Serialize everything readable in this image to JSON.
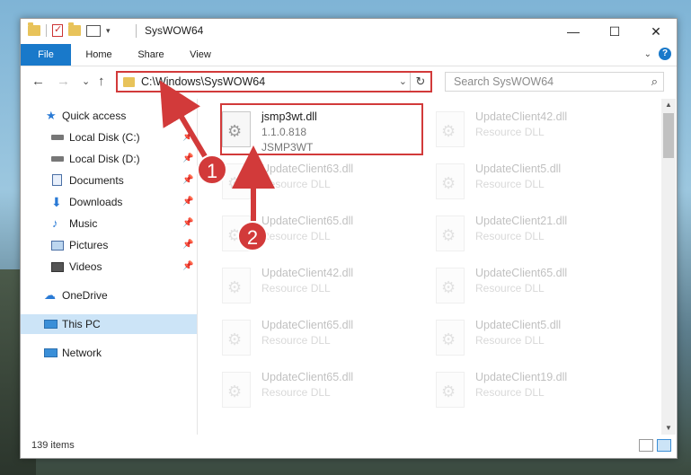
{
  "window": {
    "title": "SysWOW64",
    "controls": {
      "minimize": "—",
      "maximize": "☐",
      "close": "✕"
    }
  },
  "ribbon": {
    "tabs": [
      {
        "label": "File",
        "active": true
      },
      {
        "label": "Home"
      },
      {
        "label": "Share"
      },
      {
        "label": "View"
      }
    ]
  },
  "address_bar": {
    "path": "C:\\Windows\\SysWOW64",
    "back": "←",
    "forward": "→",
    "recent": "⌄",
    "up": "↑",
    "refresh": "↻",
    "dropdown": "⌄"
  },
  "search": {
    "placeholder": "Search SysWOW64",
    "icon": "⌕"
  },
  "nav": {
    "items": [
      {
        "label": "Quick access",
        "icon": "star-icon",
        "pinned": false
      },
      {
        "label": "Local Disk (C:)",
        "icon": "drive-icon",
        "pinned": true
      },
      {
        "label": "Local Disk (D:)",
        "icon": "drive-icon",
        "pinned": true
      },
      {
        "label": "Documents",
        "icon": "documents-icon",
        "pinned": true
      },
      {
        "label": "Downloads",
        "icon": "downloads-icon",
        "pinned": true
      },
      {
        "label": "Music",
        "icon": "music-icon",
        "pinned": true
      },
      {
        "label": "Pictures",
        "icon": "pictures-icon",
        "pinned": true
      },
      {
        "label": "Videos",
        "icon": "videos-icon",
        "pinned": true
      },
      {
        "label": "OneDrive",
        "icon": "onedrive-icon",
        "pinned": false
      },
      {
        "label": "This PC",
        "icon": "pc-icon",
        "pinned": false,
        "selected": true
      },
      {
        "label": "Network",
        "icon": "network-icon",
        "pinned": false
      }
    ]
  },
  "files": {
    "highlighted": {
      "name": "jsmp3wt.dll",
      "version": "1.1.0.818",
      "company": "JSMP3WT"
    },
    "column2": [
      {
        "name": "UpdateClient42.dll",
        "desc": "Resource DLL"
      },
      {
        "name": "UpdateClient5.dll",
        "desc": "Resource DLL"
      },
      {
        "name": "UpdateClient21.dll",
        "desc": "Resource DLL"
      },
      {
        "name": "UpdateClient65.dll",
        "desc": "Resource DLL"
      },
      {
        "name": "UpdateClient5.dll",
        "desc": "Resource DLL"
      },
      {
        "name": "UpdateClient19.dll",
        "desc": "Resource DLL"
      }
    ],
    "column1": [
      {
        "name": "UpdateClient63.dll",
        "desc": "Resource DLL"
      },
      {
        "name": "UpdateClient65.dll",
        "desc": "Resource DLL"
      },
      {
        "name": "UpdateClient42.dll",
        "desc": "Resource DLL"
      },
      {
        "name": "UpdateClient65.dll",
        "desc": "Resource DLL"
      },
      {
        "name": "UpdateClient65.dll",
        "desc": "Resource DLL"
      }
    ]
  },
  "status": {
    "item_count": "139 items"
  },
  "annotations": {
    "step1": "1",
    "step2": "2"
  },
  "colors": {
    "accent": "#1979ca",
    "annotation": "#d23a3a",
    "selected": "#cce4f7"
  }
}
